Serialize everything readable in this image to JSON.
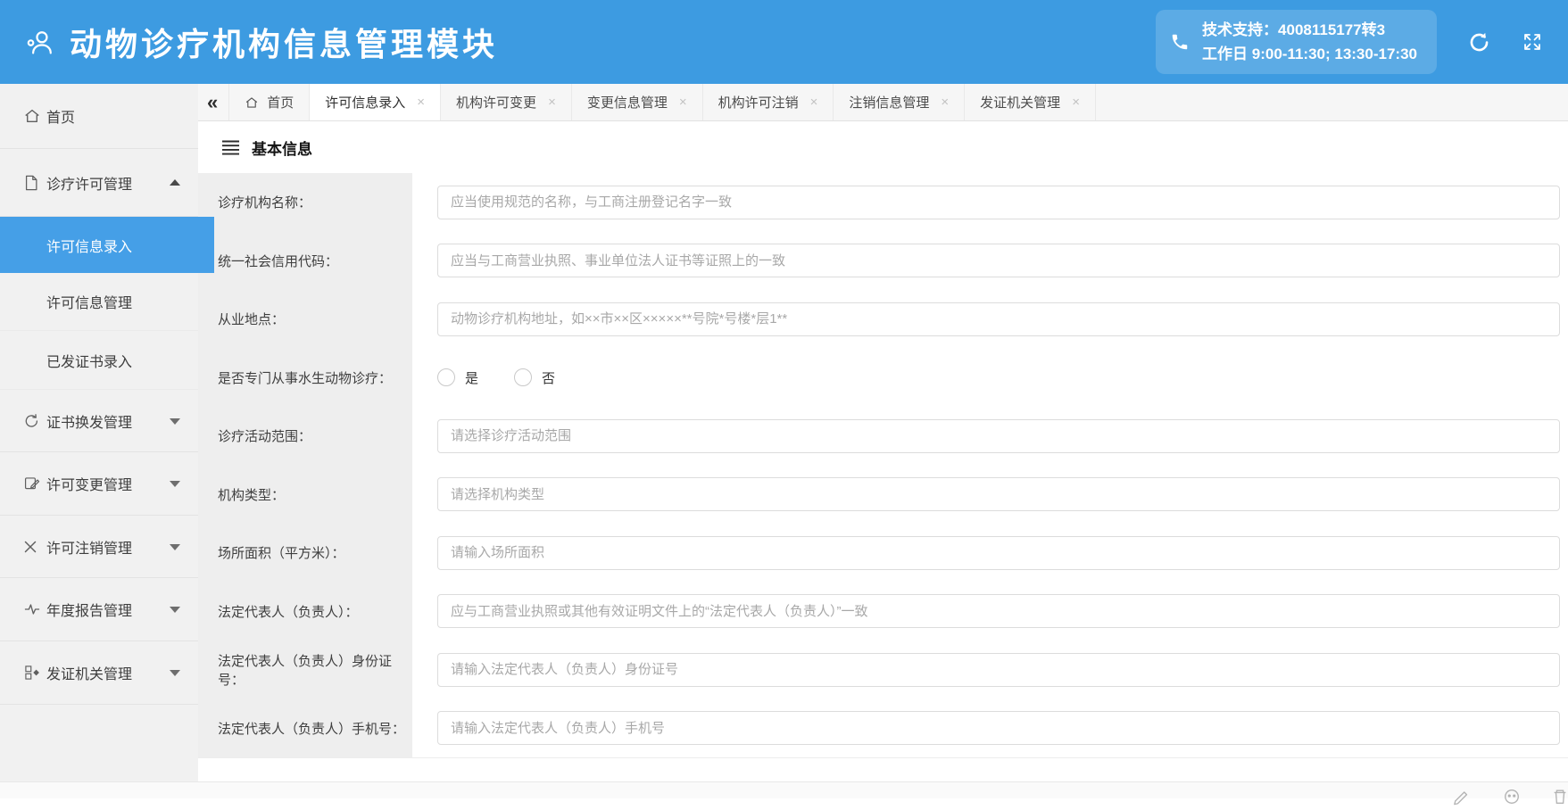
{
  "header": {
    "title": "动物诊疗机构信息管理模块",
    "support_line1": "技术支持：4008115177转3",
    "support_line2": "工作日 9:00-11:30; 13:30-17:30"
  },
  "icons": {
    "collapse_tabs": "«",
    "tab_close": "×"
  },
  "colors": {
    "header_blue": "#3d9be1",
    "active_item_blue": "#459fe7"
  },
  "sidebar": {
    "items": [
      "首页",
      "诊疗许可管理",
      "许可信息录入",
      "许可信息管理",
      "已发证书录入",
      "证书换发管理",
      "许可变更管理",
      "许可注销管理",
      "年度报告管理",
      "发证机关管理"
    ]
  },
  "tabs": {
    "items": [
      "首页",
      "许可信息录入",
      "机构许可变更",
      "变更信息管理",
      "机构许可注销",
      "注销信息管理",
      "发证机关管理"
    ],
    "active": "许可信息录入"
  },
  "section": {
    "title": "基本信息"
  },
  "form": {
    "rows": [
      {
        "label": "诊疗机构名称：",
        "placeholder": "应当使用规范的名称，与工商注册登记名字一致"
      },
      {
        "label": "统一社会信用代码：",
        "placeholder": "应当与工商营业执照、事业单位法人证书等证照上的一致"
      },
      {
        "label": "从业地点：",
        "placeholder": "动物诊疗机构地址，如××市××区×××××**号院*号楼*层1**"
      },
      {
        "label": "是否专门从事水生动物诊疗：",
        "options": [
          "是",
          "否"
        ]
      },
      {
        "label": "诊疗活动范围：",
        "placeholder": "请选择诊疗活动范围"
      },
      {
        "label": "机构类型：",
        "placeholder": "请选择机构类型"
      },
      {
        "label": "场所面积（平方米）：",
        "placeholder": "请输入场所面积"
      },
      {
        "label": "法定代表人（负责人）：",
        "placeholder": "应与工商营业执照或其他有效证明文件上的“法定代表人（负责人）”一致"
      },
      {
        "label": "法定代表人（负责人）身份证号：",
        "placeholder": "请输入法定代表人（负责人）身份证号"
      },
      {
        "label": "法定代表人（负责人）手机号：",
        "placeholder": "请输入法定代表人（负责人）手机号"
      }
    ]
  }
}
